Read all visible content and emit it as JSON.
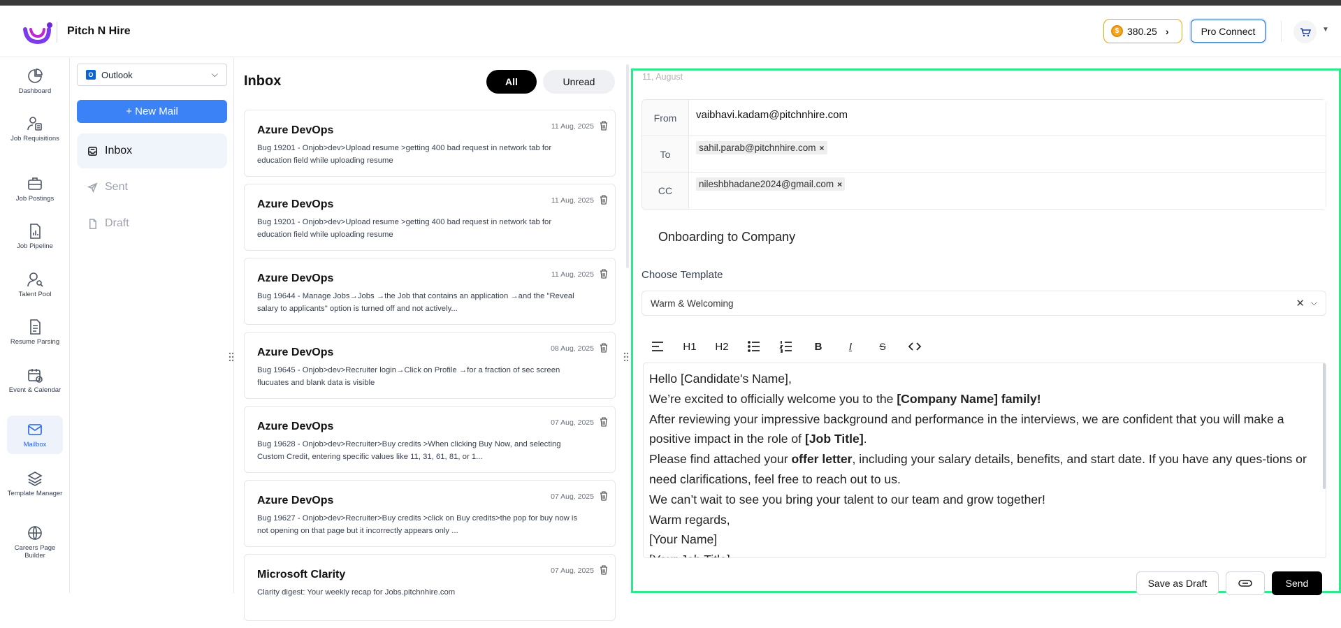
{
  "app": {
    "brand": "Pitch N Hire",
    "credits": "380.25",
    "pro_connect": "Pro Connect",
    "accent": "#3b82f6"
  },
  "nav": [
    {
      "label": "Dashboard",
      "icon": "pie-chart-icon"
    },
    {
      "label": "Job Requisitions",
      "icon": "user-clipboard-icon"
    },
    {
      "label": "Job Postings",
      "icon": "briefcase-icon"
    },
    {
      "label": "Job Pipeline",
      "icon": "bar-chart-doc-icon"
    },
    {
      "label": "Talent Pool",
      "icon": "user-search-icon"
    },
    {
      "label": "Resume Parsing",
      "icon": "document-icon"
    },
    {
      "label": "Event & Calendar",
      "icon": "calendar-clock-icon"
    },
    {
      "label": "Mailbox",
      "icon": "mail-icon"
    },
    {
      "label": "Template Manager",
      "icon": "layers-icon"
    },
    {
      "label": "Careers Page Builder",
      "icon": "globe-icon"
    }
  ],
  "folders": {
    "provider": "Outlook",
    "new_mail": "+ New Mail",
    "items": [
      "Inbox",
      "Sent",
      "Draft"
    ]
  },
  "inbox": {
    "title": "Inbox",
    "filter_all": "All",
    "filter_unread": "Unread",
    "mails": [
      {
        "from": "Azure DevOps",
        "date": "11 Aug, 2025",
        "snippet": "Bug 19201 - Onjob>dev>Upload resume >getting 400 bad request in network tab for education field while uploading resume"
      },
      {
        "from": "Azure DevOps",
        "date": "11 Aug, 2025",
        "snippet": "Bug 19201 - Onjob>dev>Upload resume >getting 400 bad request in network tab for education field while uploading resume"
      },
      {
        "from": "Azure DevOps",
        "date": "11 Aug, 2025",
        "snippet": "Bug 19644 - Manage Jobs→Jobs →the Job that contains an application →and the \"Reveal salary to applicants\" option is turned off and not actively..."
      },
      {
        "from": "Azure DevOps",
        "date": "08 Aug, 2025",
        "snippet": "Bug 19645 - Onjob>dev>Recruiter login→Click on Profile →for a fraction of sec screen flucuates and blank data is visible"
      },
      {
        "from": "Azure DevOps",
        "date": "07 Aug, 2025",
        "snippet": "Bug 19628 - Onjob>dev>Recruiter>Buy credits >When clicking Buy Now, and selecting Custom Credit, entering specific values like 11, 31, 61, 81, or 1..."
      },
      {
        "from": "Azure DevOps",
        "date": "07 Aug, 2025",
        "snippet": "Bug 19627 - Onjob>dev>Recruiter>Buy credits >click on Buy credits>the pop for buy now is not opening on that page but it incorrectly appears only ..."
      },
      {
        "from": "Microsoft Clarity",
        "date": "07 Aug, 2025",
        "snippet": "Clarity digest: Your weekly recap for Jobs.pitchnhire.com"
      }
    ]
  },
  "compose": {
    "date": "11, August",
    "from_label": "From",
    "from_value": "vaibhavi.kadam@pitchnhire.com",
    "to_label": "To",
    "to_chip": "sahil.parab@pitchnhire.com",
    "cc_label": "CC",
    "cc_chip": "nileshbhadane2024@gmail.com",
    "subject": "Onboarding to Company",
    "choose_template_label": "Choose Template",
    "template_value": "Warm & Welcoming",
    "toolbar": {
      "h1": "H1",
      "h2": "H2",
      "bold": "B",
      "italic": "I",
      "strike": "S"
    },
    "body": {
      "greeting": "Hello [Candidate's Name],",
      "l2a": "We’re excited to officially welcome you to the ",
      "l2b": "[Company Name] family!",
      "l3a": "After reviewing your impressive background and performance in the interviews, we are confident that you will make a positive impact in the role of ",
      "l3b": "[Job Title]",
      "l3c": ".",
      "l4a": "Please find attached your ",
      "l4b": "offer letter",
      "l4c": ", including your salary details, benefits, and start date. If you have any ques-tions or need clarifications, feel free to reach out to us.",
      "l5": "We can’t wait to see you bring your talent to our team and grow together!",
      "l6": "Warm regards,",
      "l7": "[Your Name]",
      "l8": "[Your Job Title]"
    },
    "save_draft": "Save as Draft",
    "send": "Send"
  }
}
